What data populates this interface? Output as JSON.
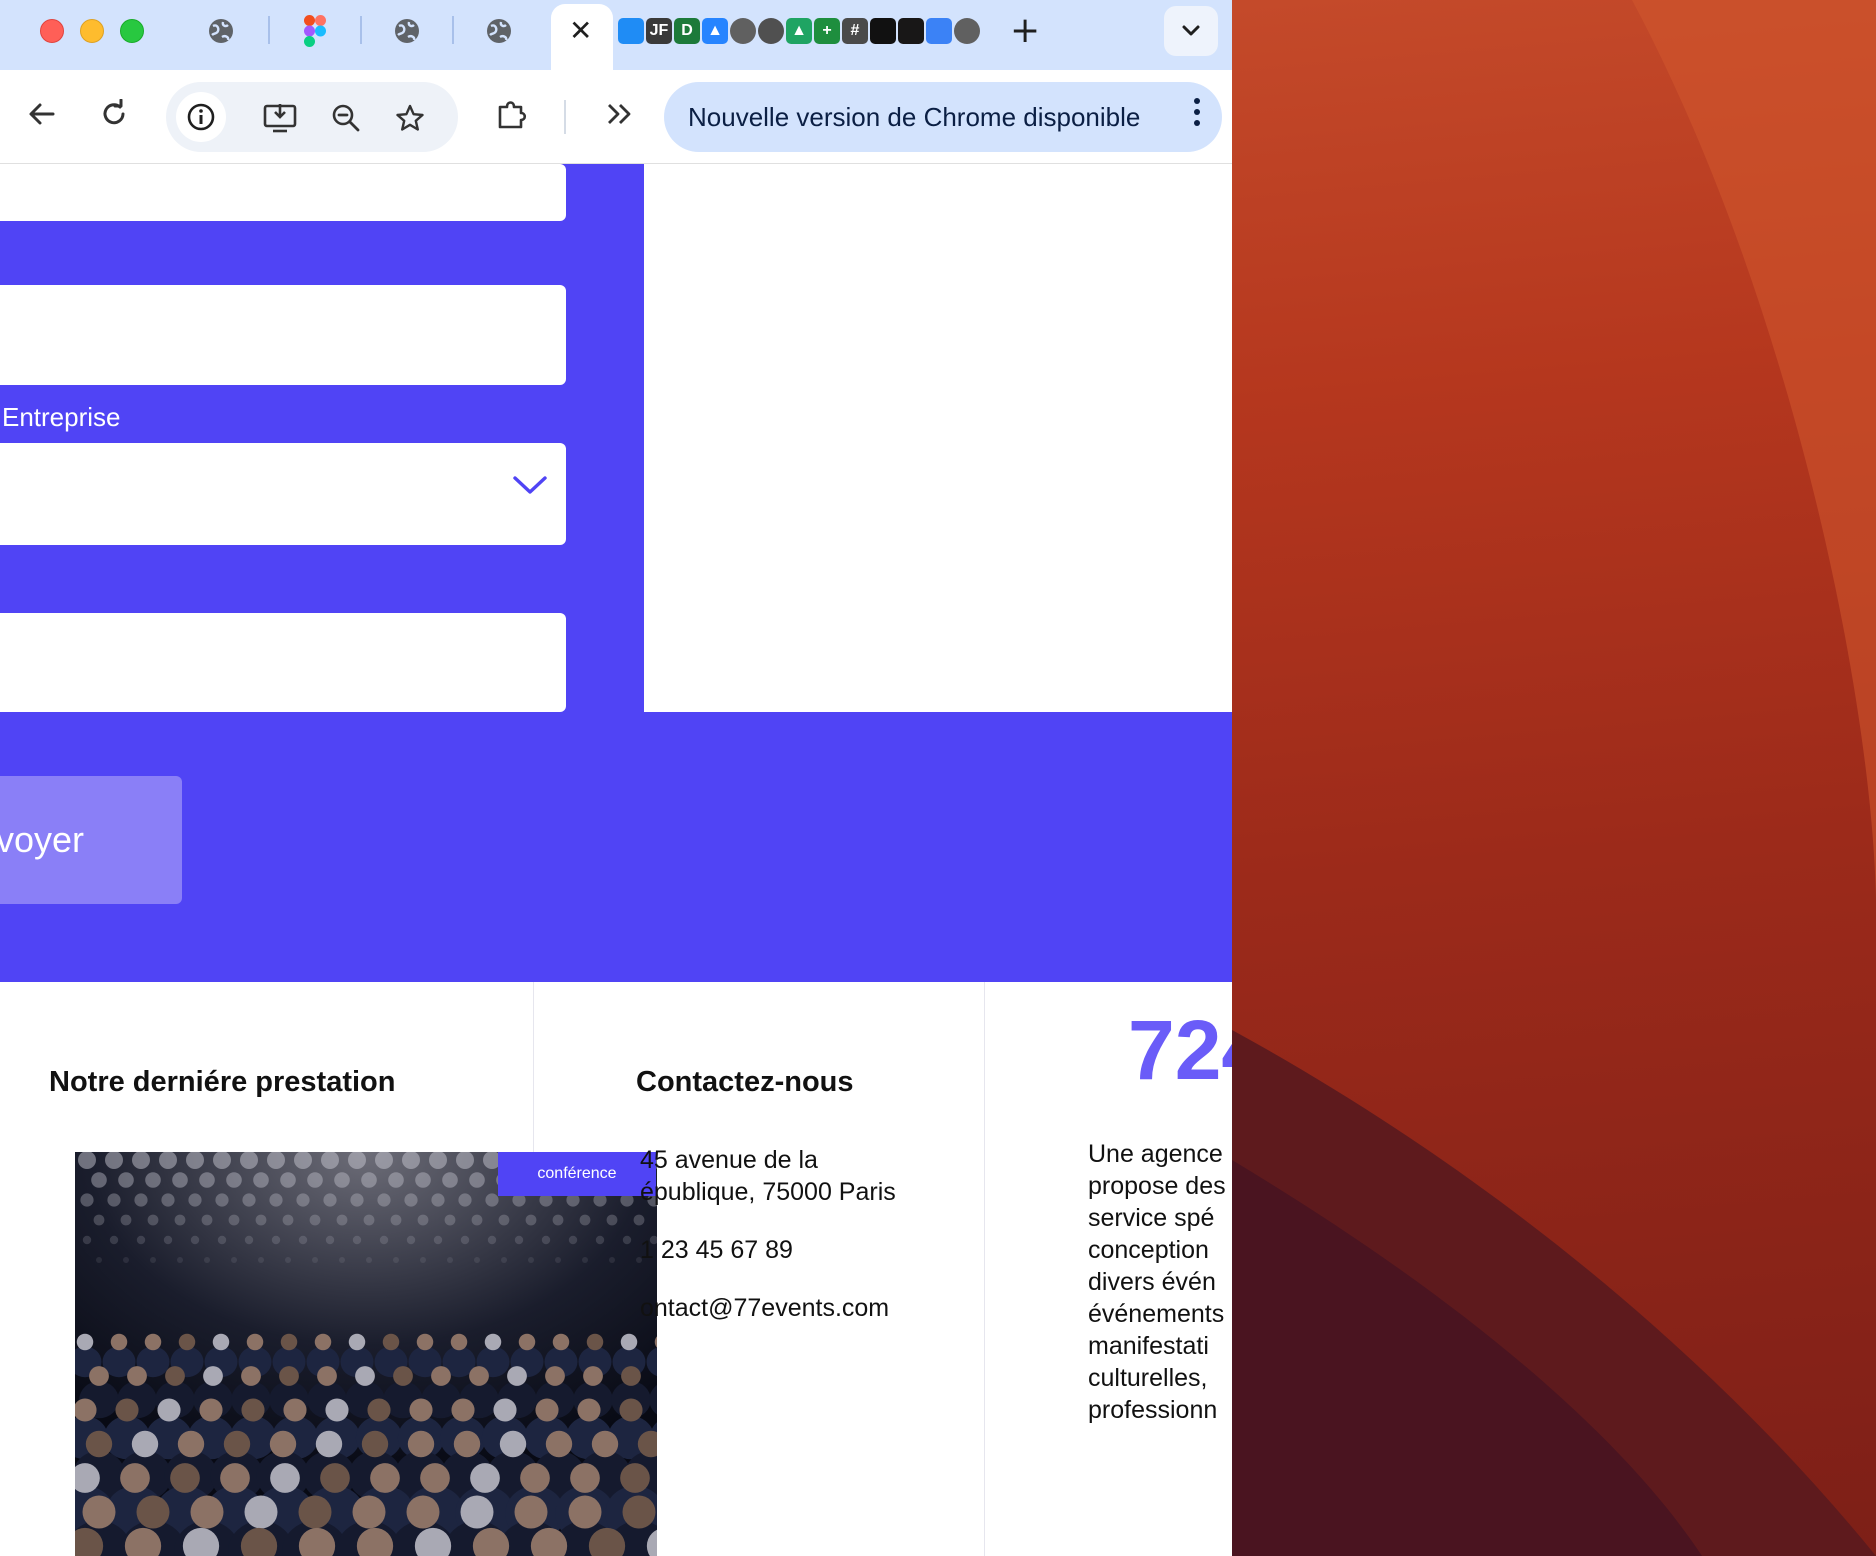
{
  "browser": {
    "active_tab_close": "✕",
    "new_tab": "+",
    "mini_favicons": [
      {
        "icon": "app-store-icon",
        "label": "",
        "color": "#1f8cf5"
      },
      {
        "icon": "jf-icon",
        "label": "JF",
        "color": "#3a3a3a"
      },
      {
        "icon": "d-icon",
        "label": "D",
        "color": "#1d7a3a"
      },
      {
        "icon": "atlassian-icon",
        "label": "▲",
        "color": "#2684ff"
      },
      {
        "icon": "globe-icon",
        "label": "",
        "color": "#606060"
      },
      {
        "icon": "globe-icon",
        "label": "",
        "color": "#505050"
      },
      {
        "icon": "drive-icon",
        "label": "▲",
        "color": "#1fa463"
      },
      {
        "icon": "plus-app-icon",
        "label": "+",
        "color": "#1e8e3e"
      },
      {
        "icon": "slack-icon",
        "label": "#",
        "color": "#4a4a4a"
      },
      {
        "icon": "openai-icon",
        "label": "",
        "color": "#111111"
      },
      {
        "icon": "github-icon",
        "label": "",
        "color": "#181717"
      },
      {
        "icon": "cloud-icon",
        "label": "",
        "color": "#3b82f6"
      },
      {
        "icon": "globe-icon",
        "label": "",
        "color": "#606060"
      }
    ],
    "update_text": "Nouvelle version de Chrome disponible"
  },
  "form": {
    "company_label": "Entreprise",
    "submit_label": "voyer"
  },
  "footer": {
    "prestation_title": "Notre derniére prestation",
    "prestation_badge": "conférence",
    "contact_title": "Contactez-nous",
    "address_line1": "45 avenue de la",
    "address_line2": "épublique, 75000 Paris",
    "phone": "1 23 45 67 89",
    "email": "ontact@77events.com",
    "stat_number": "724",
    "about_lines": [
      "Une agence",
      "propose des",
      "service spé",
      "conception",
      "divers évén",
      "événements",
      "manifestati",
      "culturelles,",
      "professionn"
    ]
  },
  "colors": {
    "brand": "#5044f5",
    "button": "#8a7ff7",
    "tabbar": "#d3e3fd"
  }
}
